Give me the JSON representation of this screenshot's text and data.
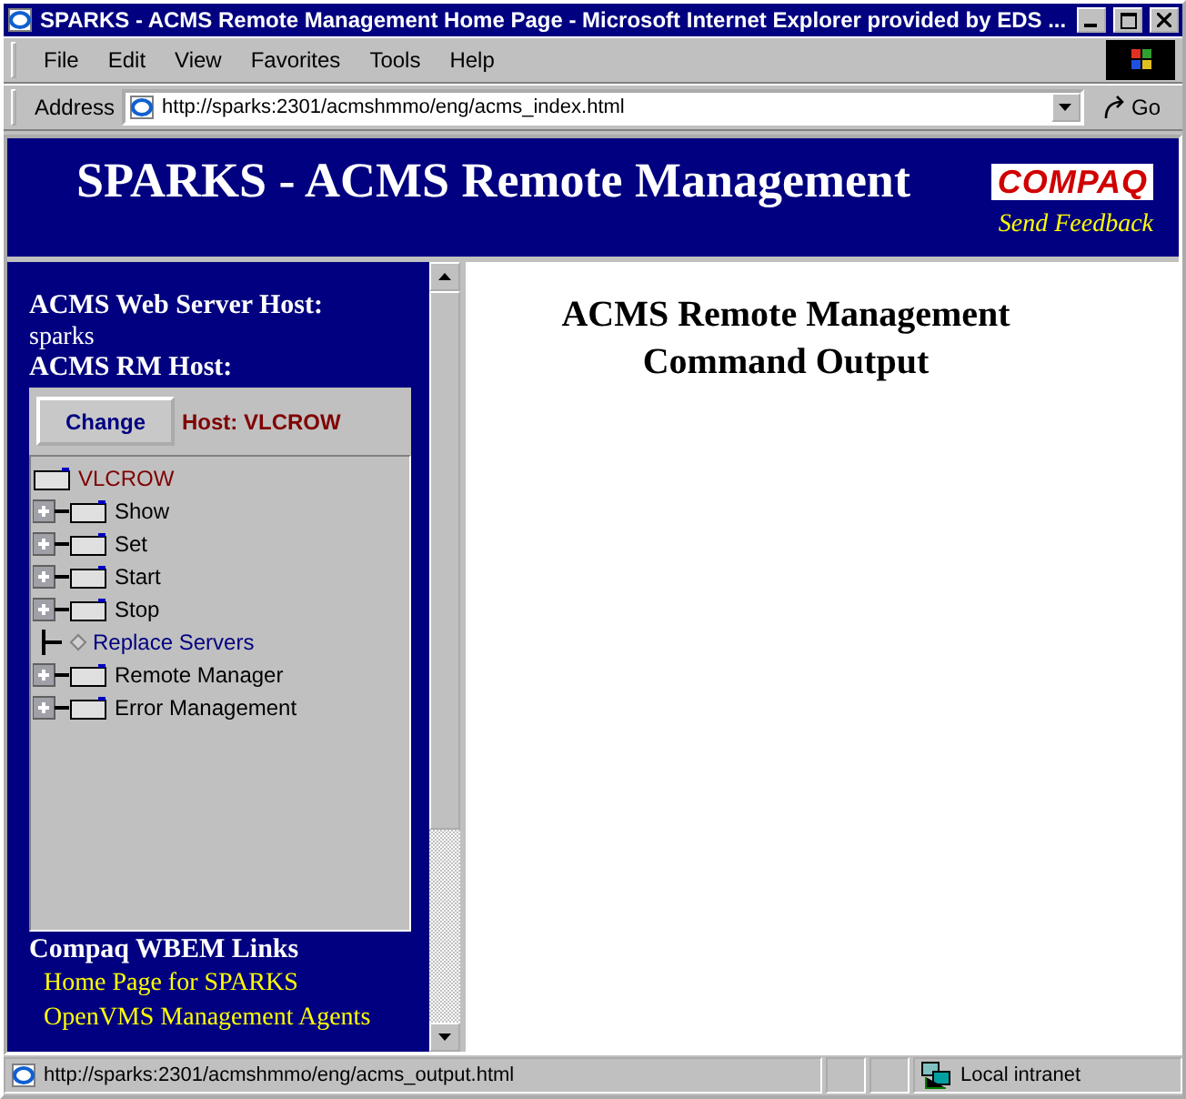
{
  "window": {
    "title": "SPARKS - ACMS Remote Management Home Page - Microsoft Internet Explorer provided by EDS ..."
  },
  "menu": [
    "File",
    "Edit",
    "View",
    "Favorites",
    "Tools",
    "Help"
  ],
  "address": {
    "label": "Address",
    "value": "http://sparks:2301/acmshmmo/eng/acms_index.html",
    "go": "Go"
  },
  "header": {
    "title": "SPARKS - ACMS Remote Management",
    "logo": "COMPAQ",
    "feedback": "Send Feedback"
  },
  "left_frame": {
    "server_label": "ACMS Web Server Host:",
    "server_value": "sparks",
    "rm_label": "ACMS RM Host:",
    "change_button": "Change",
    "host": "Host: VLCROW",
    "tree": {
      "label": "VLCROW",
      "children": [
        {
          "label": "Show",
          "kind": "folder",
          "expanded": false
        },
        {
          "label": "Set",
          "kind": "folder",
          "expanded": false
        },
        {
          "label": "Start",
          "kind": "folder",
          "expanded": false
        },
        {
          "label": "Stop",
          "kind": "folder",
          "expanded": false
        },
        {
          "label": "Replace Servers",
          "kind": "link"
        },
        {
          "label": "Remote Manager",
          "kind": "folder",
          "expanded": false
        },
        {
          "label": "Error Management",
          "kind": "folder",
          "expanded": false
        }
      ]
    },
    "links_heading": "Compaq WBEM Links",
    "links": [
      "Home Page for SPARKS",
      "OpenVMS Management Agents"
    ]
  },
  "content": {
    "title_lines": [
      "ACMS Remote Management",
      "Command Output"
    ]
  },
  "status_bar": {
    "url": "http://sparks:2301/acmshmmo/eng/acms_output.html",
    "zone": "Local intranet"
  }
}
